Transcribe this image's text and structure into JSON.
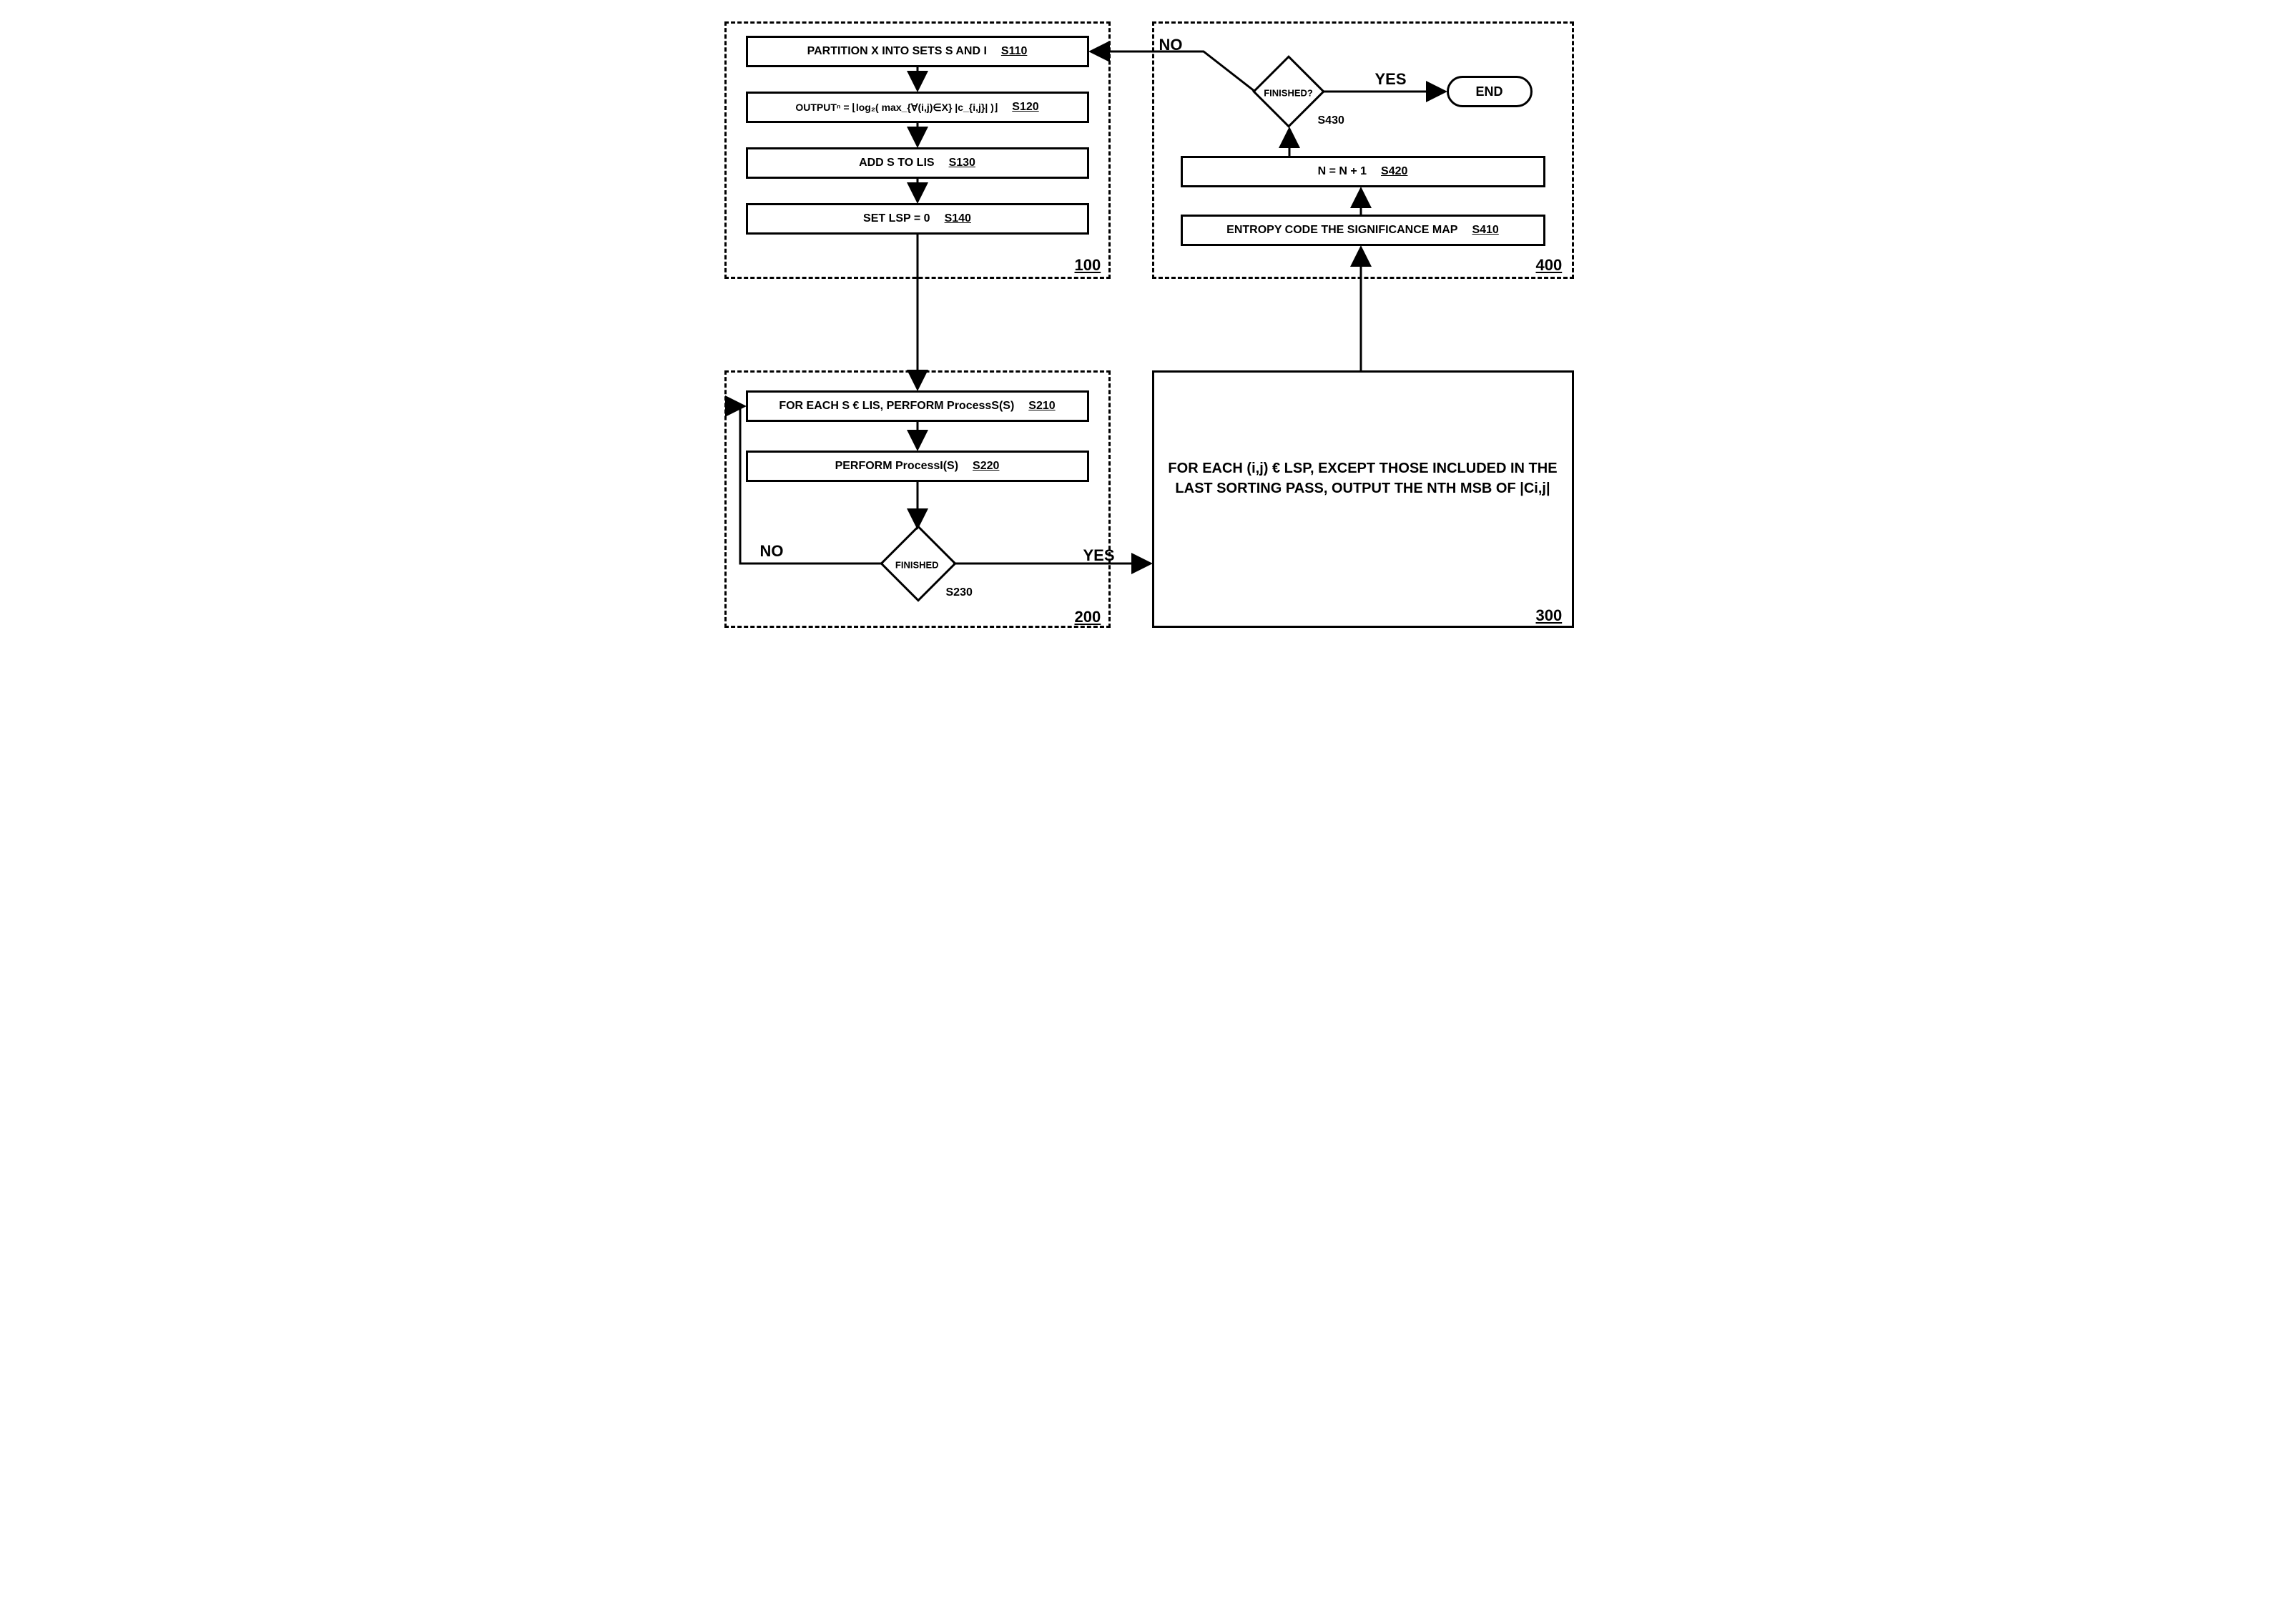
{
  "block100": {
    "ref": "100",
    "s110": {
      "text": "PARTITION X INTO SETS S AND I",
      "ref": "S110"
    },
    "s120": {
      "text": "OUTPUTⁿ = ⌊log₂( max_{∀(i,j)∈X} |c_{i,j}| )⌋",
      "ref": "S120"
    },
    "s130": {
      "text": "ADD S TO LIS",
      "ref": "S130"
    },
    "s140": {
      "text": "SET LSP = 0",
      "ref": "S140"
    }
  },
  "block200": {
    "ref": "200",
    "s210": {
      "text": "FOR EACH S € LIS, PERFORM ProcessS(S)",
      "ref": "S210"
    },
    "s220": {
      "text": "PERFORM ProcessI(S)",
      "ref": "S220"
    },
    "s230": {
      "text": "FINISHED",
      "ref": "S230"
    },
    "no": "NO",
    "yes": "YES"
  },
  "block300": {
    "ref": "300",
    "text": "FOR EACH (i,j) € LSP,\nEXCEPT THOSE INCLUDED IN THE LAST\nSORTING PASS,\nOUTPUT THE NTH MSB OF |Ci,j|"
  },
  "block400": {
    "ref": "400",
    "s410": {
      "text": "ENTROPY CODE THE SIGNIFICANCE MAP",
      "ref": "S410"
    },
    "s420": {
      "text": "N = N + 1",
      "ref": "S420"
    },
    "s430": {
      "text": "FINISHED?",
      "ref": "S430"
    },
    "no": "NO",
    "yes": "YES",
    "end": "END"
  }
}
